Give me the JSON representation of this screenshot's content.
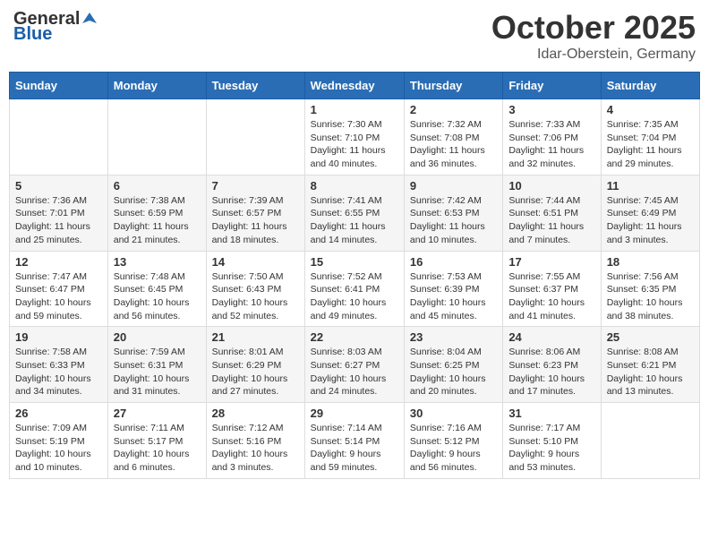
{
  "header": {
    "logo_general": "General",
    "logo_blue": "Blue",
    "month_title": "October 2025",
    "location": "Idar-Oberstein, Germany"
  },
  "weekdays": [
    "Sunday",
    "Monday",
    "Tuesday",
    "Wednesday",
    "Thursday",
    "Friday",
    "Saturday"
  ],
  "weeks": [
    [
      {
        "day": "",
        "info": ""
      },
      {
        "day": "",
        "info": ""
      },
      {
        "day": "",
        "info": ""
      },
      {
        "day": "1",
        "info": "Sunrise: 7:30 AM\nSunset: 7:10 PM\nDaylight: 11 hours\nand 40 minutes."
      },
      {
        "day": "2",
        "info": "Sunrise: 7:32 AM\nSunset: 7:08 PM\nDaylight: 11 hours\nand 36 minutes."
      },
      {
        "day": "3",
        "info": "Sunrise: 7:33 AM\nSunset: 7:06 PM\nDaylight: 11 hours\nand 32 minutes."
      },
      {
        "day": "4",
        "info": "Sunrise: 7:35 AM\nSunset: 7:04 PM\nDaylight: 11 hours\nand 29 minutes."
      }
    ],
    [
      {
        "day": "5",
        "info": "Sunrise: 7:36 AM\nSunset: 7:01 PM\nDaylight: 11 hours\nand 25 minutes."
      },
      {
        "day": "6",
        "info": "Sunrise: 7:38 AM\nSunset: 6:59 PM\nDaylight: 11 hours\nand 21 minutes."
      },
      {
        "day": "7",
        "info": "Sunrise: 7:39 AM\nSunset: 6:57 PM\nDaylight: 11 hours\nand 18 minutes."
      },
      {
        "day": "8",
        "info": "Sunrise: 7:41 AM\nSunset: 6:55 PM\nDaylight: 11 hours\nand 14 minutes."
      },
      {
        "day": "9",
        "info": "Sunrise: 7:42 AM\nSunset: 6:53 PM\nDaylight: 11 hours\nand 10 minutes."
      },
      {
        "day": "10",
        "info": "Sunrise: 7:44 AM\nSunset: 6:51 PM\nDaylight: 11 hours\nand 7 minutes."
      },
      {
        "day": "11",
        "info": "Sunrise: 7:45 AM\nSunset: 6:49 PM\nDaylight: 11 hours\nand 3 minutes."
      }
    ],
    [
      {
        "day": "12",
        "info": "Sunrise: 7:47 AM\nSunset: 6:47 PM\nDaylight: 10 hours\nand 59 minutes."
      },
      {
        "day": "13",
        "info": "Sunrise: 7:48 AM\nSunset: 6:45 PM\nDaylight: 10 hours\nand 56 minutes."
      },
      {
        "day": "14",
        "info": "Sunrise: 7:50 AM\nSunset: 6:43 PM\nDaylight: 10 hours\nand 52 minutes."
      },
      {
        "day": "15",
        "info": "Sunrise: 7:52 AM\nSunset: 6:41 PM\nDaylight: 10 hours\nand 49 minutes."
      },
      {
        "day": "16",
        "info": "Sunrise: 7:53 AM\nSunset: 6:39 PM\nDaylight: 10 hours\nand 45 minutes."
      },
      {
        "day": "17",
        "info": "Sunrise: 7:55 AM\nSunset: 6:37 PM\nDaylight: 10 hours\nand 41 minutes."
      },
      {
        "day": "18",
        "info": "Sunrise: 7:56 AM\nSunset: 6:35 PM\nDaylight: 10 hours\nand 38 minutes."
      }
    ],
    [
      {
        "day": "19",
        "info": "Sunrise: 7:58 AM\nSunset: 6:33 PM\nDaylight: 10 hours\nand 34 minutes."
      },
      {
        "day": "20",
        "info": "Sunrise: 7:59 AM\nSunset: 6:31 PM\nDaylight: 10 hours\nand 31 minutes."
      },
      {
        "day": "21",
        "info": "Sunrise: 8:01 AM\nSunset: 6:29 PM\nDaylight: 10 hours\nand 27 minutes."
      },
      {
        "day": "22",
        "info": "Sunrise: 8:03 AM\nSunset: 6:27 PM\nDaylight: 10 hours\nand 24 minutes."
      },
      {
        "day": "23",
        "info": "Sunrise: 8:04 AM\nSunset: 6:25 PM\nDaylight: 10 hours\nand 20 minutes."
      },
      {
        "day": "24",
        "info": "Sunrise: 8:06 AM\nSunset: 6:23 PM\nDaylight: 10 hours\nand 17 minutes."
      },
      {
        "day": "25",
        "info": "Sunrise: 8:08 AM\nSunset: 6:21 PM\nDaylight: 10 hours\nand 13 minutes."
      }
    ],
    [
      {
        "day": "26",
        "info": "Sunrise: 7:09 AM\nSunset: 5:19 PM\nDaylight: 10 hours\nand 10 minutes."
      },
      {
        "day": "27",
        "info": "Sunrise: 7:11 AM\nSunset: 5:17 PM\nDaylight: 10 hours\nand 6 minutes."
      },
      {
        "day": "28",
        "info": "Sunrise: 7:12 AM\nSunset: 5:16 PM\nDaylight: 10 hours\nand 3 minutes."
      },
      {
        "day": "29",
        "info": "Sunrise: 7:14 AM\nSunset: 5:14 PM\nDaylight: 9 hours\nand 59 minutes."
      },
      {
        "day": "30",
        "info": "Sunrise: 7:16 AM\nSunset: 5:12 PM\nDaylight: 9 hours\nand 56 minutes."
      },
      {
        "day": "31",
        "info": "Sunrise: 7:17 AM\nSunset: 5:10 PM\nDaylight: 9 hours\nand 53 minutes."
      },
      {
        "day": "",
        "info": ""
      }
    ]
  ]
}
